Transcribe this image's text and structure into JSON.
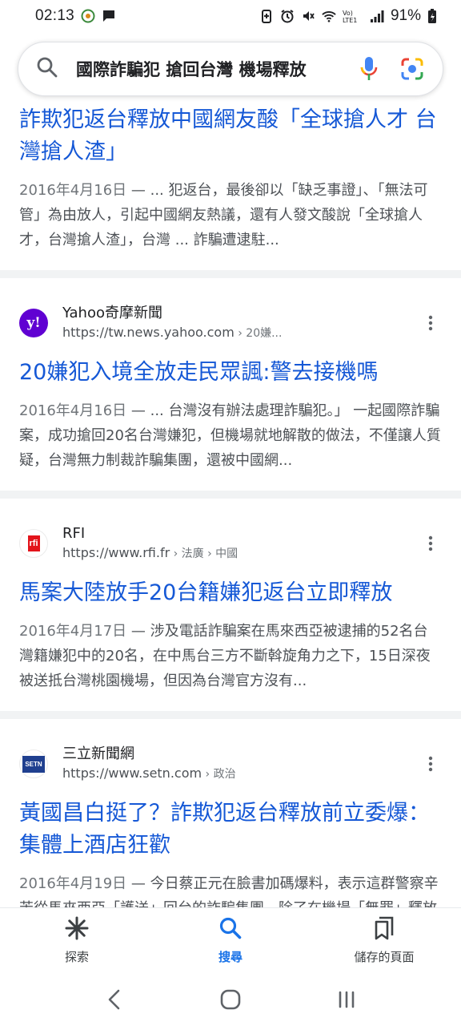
{
  "status_bar": {
    "time": "02:13",
    "battery": "91%"
  },
  "search": {
    "query": "國際詐騙犯 搶回台灣 機場釋放"
  },
  "results": [
    {
      "title": "詐欺犯返台釋放中國網友酸「全球搶人才 台灣搶人渣」",
      "date": "2016年4月16日",
      "snippet": " — ... 犯返台，最後卻以「缺乏事證」、「無法可管」為由放人，引起中國網友熱議，還有人發文酸說「全球搶人才，台灣搶人渣」，台灣 ... 詐騙遭逮駐..."
    },
    {
      "source_name": "Yahoo奇摩新聞",
      "source_url": "https://tw.news.yahoo.com",
      "source_crumb": " › 20嫌...",
      "title": "20嫌犯入境全放走民眾諷:警去接機嗎",
      "date": "2016年4月16日",
      "snippet": " — ... 台灣沒有辦法處理詐騙犯。」 一起國際詐騙案，成功搶回20名台灣嫌犯，但機場就地解散的做法，不僅讓人質疑，台灣無力制裁詐騙集團，還被中國網..."
    },
    {
      "source_name": "RFI",
      "source_url": "https://www.rfi.fr",
      "source_crumb": " › 法廣 › 中國",
      "title": "馬案大陸放手20台籍嫌犯返台立即釋放",
      "date": "2016年4月17日",
      "snippet": " — 涉及電話詐騙案在馬來西亞被逮捕的52名台灣籍嫌犯中的20名，在中馬台三方不斷斡旋角力之下，15日深夜被送抵台灣桃園機場，但因為台灣官方沒有..."
    },
    {
      "source_name": "三立新聞網",
      "source_url": "https://www.setn.com",
      "source_crumb": " › 政治",
      "title": "黃國昌白挺了？詐欺犯返台釋放前立委爆：集體上酒店狂歡",
      "date": "2016年4月19日",
      "snippet": " — 今日蔡正元在臉書加碼爆料，表示這群警察辛苦從馬來西亞「護送」回台的詐騙集團，除了在機場「無罪」釋放外，當晚還集體赴酒店狂歡；至於開趴地..."
    }
  ],
  "favicons": {
    "yahoo": "y!",
    "rfi": "rfi",
    "setn": "SETN"
  },
  "bottom_nav": {
    "discover": "探索",
    "search": "搜尋",
    "saved": "儲存的頁面"
  },
  "colors": {
    "link": "#1558d6",
    "accent": "#1a73e8",
    "yahoo": "#6001d2",
    "rfi": "#e3141b",
    "setn": "#1f3f8f"
  }
}
